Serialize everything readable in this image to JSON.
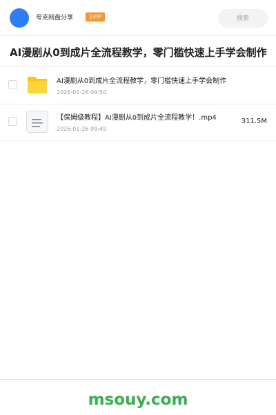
{
  "header": {
    "app_name": "夸克网盘分享",
    "badge": "SVIP",
    "search_placeholder": "搜索"
  },
  "page_title": "AI漫剧从0到成片全流程教学，零门槛快速上手学会制作",
  "files": [
    {
      "name": "AI漫剧从0到成片全流程教学，零门槛快速上手学会制作",
      "date": "2026-01-26 09:50",
      "size": "",
      "icon": "folder-icon"
    },
    {
      "name": "【保姆级教程】AI漫剧从0到成片全流程教学！.mp4",
      "date": "2026-01-26 09:49",
      "size": "311.5M",
      "icon": "document-icon"
    }
  ],
  "footer": {
    "brand": "msouy.com"
  },
  "colors": {
    "avatar": "#2c7df6",
    "badge": "#f7962f",
    "folder": "#fcc419",
    "brand": "#33b249"
  }
}
